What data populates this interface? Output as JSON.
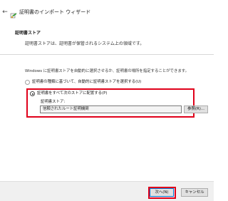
{
  "window": {
    "back_glyph": "←",
    "title": "証明書のインポート ウィザード",
    "icon": "certificate-wizard-icon"
  },
  "section": {
    "title": "証明書ストア",
    "description": "証明書ストアは、証明書が保管されるシステム上の領域です。"
  },
  "body": {
    "info": "Windows に証明書ストアを自動的に選択させるか、証明書の場所を指定することができます。",
    "options": [
      {
        "label": "証明書の種類に基づいて、自動的に証明書ストアを選択する(U)",
        "selected": false,
        "enabled": false
      },
      {
        "label": "証明書をすべて次のストアに配置する(P)",
        "selected": true,
        "enabled": true
      }
    ],
    "store_label": "証明書ストア:",
    "store_value": "信頼されたルート証明機関",
    "browse_button": "参照(R)..."
  },
  "footer": {
    "next_button": "次へ(N)",
    "cancel_button": "キャンセル"
  },
  "colors": {
    "highlight": "#e0001a",
    "accent": "#0078d7",
    "footer_bg": "#f0f0f0"
  }
}
